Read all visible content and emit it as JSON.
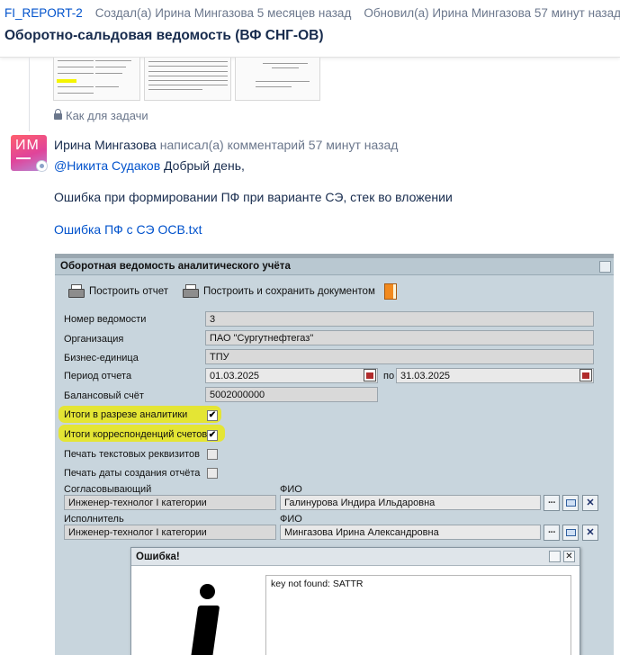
{
  "issue": {
    "key": "FI_REPORT-2",
    "created": "Создал(а) Ирина Мингазова 5 месяцев назад",
    "updated": "Обновил(а) Ирина Мингазова 57 минут назад",
    "title": "Оборотно-сальдовая ведомость (ВФ СНГ-ОВ)"
  },
  "restriction": "Как для задачи",
  "comment": {
    "avatar_initials": "ИМ",
    "author": "Ирина Мингазова",
    "action": "написал(а) комментарий 57 минут назад",
    "mention": "@Никита Судаков",
    "greeting": "Добрый день,",
    "body": "Ошибка при формировании ПФ при варианте СЭ, стек во вложении",
    "attachment": "Ошибка ПФ с СЭ ОСВ.txt"
  },
  "screenshot": {
    "window_title": "Оборотная ведомость аналитического учёта",
    "build_report": "Построить отчет",
    "build_save": "Построить и сохранить документом",
    "fields": {
      "number_label": "Номер ведомости",
      "number_value": "3",
      "org_label": "Организация",
      "org_value": "ПАО \"Сургутнефтегаз\"",
      "unit_label": "Бизнес-единица",
      "unit_value": "ТПУ",
      "period_label": "Период отчета",
      "period_from": "01.03.2025",
      "period_to_label": "по",
      "period_to": "31.03.2025",
      "account_label": "Балансовый счёт",
      "account_value": "5002000000"
    },
    "checks": {
      "analytics_label": "Итоги в разрезе аналитики",
      "analytics": true,
      "corr_label": "Итоги корреспонденций счетов",
      "corr": true,
      "text_req_label": "Печать текстовых реквизитов",
      "text_req": false,
      "date_label": "Печать даты создания отчёта",
      "date": false
    },
    "approver": {
      "role_label": "Согласовывающий",
      "fio_label": "ФИО",
      "role": "Инженер-технолог I категории",
      "fio": "Галинурова Индира Ильдаровна"
    },
    "executor": {
      "role_label": "Исполнитель",
      "fio_label": "ФИО",
      "role": "Инженер-технолог I категории",
      "fio": "Мингазова  Ирина Александровна"
    },
    "dialog": {
      "title": "Ошибка!",
      "message": "key not found: SATTR"
    }
  }
}
